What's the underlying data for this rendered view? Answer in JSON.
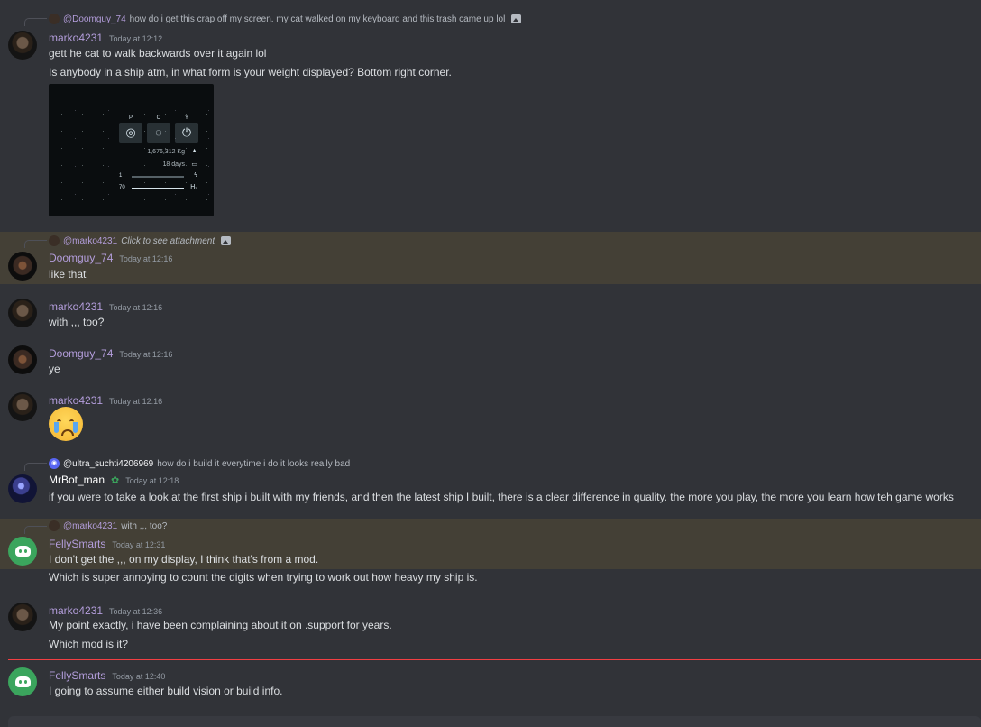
{
  "messages": [
    {
      "reply": {
        "author": "@Doomguy_74",
        "text": "how do i get this crap off my screen. my cat walked on my keyboard and this trash came up lol",
        "has_image": true
      },
      "author": "marko4231",
      "timestamp": "Today at 12:12",
      "lines": [
        "gett he cat to walk backwards over it again lol",
        "Is anybody in a ship atm, in what form is your weight displayed? Bottom right corner."
      ],
      "attachment": {
        "keys": [
          "P",
          "O",
          "Y"
        ],
        "mass": "1,676,312 Kg",
        "days": "18 days",
        "row1_value": "1",
        "row2_value": "70",
        "row1_fill": 0,
        "row2_fill": 1,
        "fuel_label": "H₂"
      }
    },
    {
      "reply": {
        "author": "@marko4231",
        "text": "Click to see attachment",
        "has_image": true
      },
      "author": "Doomguy_74",
      "timestamp": "Today at 12:16",
      "lines": [
        "like that"
      ],
      "highlighted": true
    },
    {
      "author": "marko4231",
      "timestamp": "Today at 12:16",
      "lines": [
        "with ,,, too?"
      ]
    },
    {
      "author": "Doomguy_74",
      "timestamp": "Today at 12:16",
      "lines": [
        "ye"
      ]
    },
    {
      "author": "marko4231",
      "timestamp": "Today at 12:16",
      "emoji": "crying-face"
    },
    {
      "reply": {
        "author": "@ultra_suchti4206969",
        "text": "how do i build it everytime i do it looks really bad",
        "has_image": false
      },
      "author": "MrBot_man",
      "timestamp": "Today at 12:18",
      "lines": [
        "if you were to take a look at the first ship i built with my friends, and then the latest ship I built, there is a clear difference in quality. the more you play, the more you learn how teh game works"
      ]
    },
    {
      "reply": {
        "author": "@marko4231",
        "text": "with ,,, too?",
        "has_image": false
      },
      "author": "FellySmarts",
      "timestamp": "Today at 12:31",
      "lines": [
        "I don't get the ,,, on my display, I think that's from a mod.",
        "Which is super annoying to count the digits when trying to work out how heavy my ship is."
      ],
      "highlighted": true
    },
    {
      "author": "marko4231",
      "timestamp": "Today at 12:36",
      "lines": [
        "My point exactly, i have been complaining about it on .support for years.",
        "Which mod is it?"
      ]
    },
    {
      "author": "FellySmarts",
      "timestamp": "Today at 12:40",
      "lines": [
        "I going to assume either build vision or build info."
      ]
    }
  ],
  "colors": {
    "username": "#b39ddb",
    "mention_bg": "#444036",
    "new_divider": "#f23f43",
    "background": "#313338"
  }
}
